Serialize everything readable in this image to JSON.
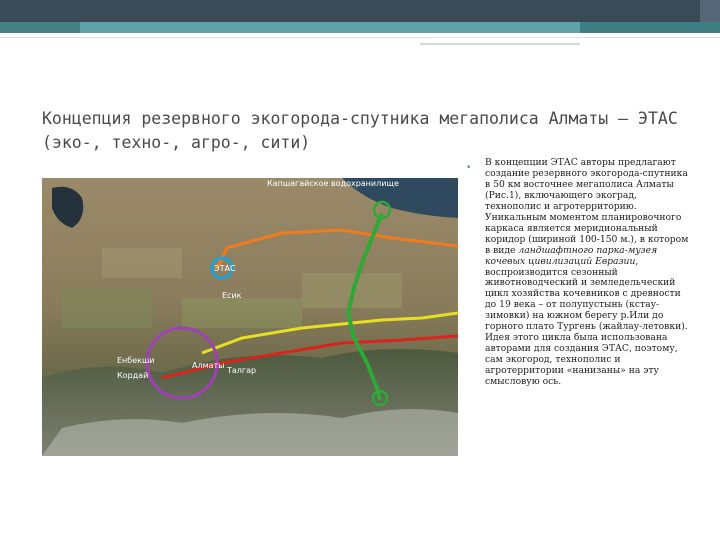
{
  "slide": {
    "title": "Концепция резервного экогорода-спутника мегаполиса Алматы – ЭТАС (эко-, техно-, агро-, сити)"
  },
  "map": {
    "labels": {
      "lake": "Капшагайское водохранилище",
      "city_left": "Енбекши",
      "city_mid": "Алматы",
      "city_mid_left": "Кордай",
      "region": "Талгар",
      "village": "Есик",
      "site": "ЭТАС"
    },
    "route_colors": {
      "orange": "#f07a1c",
      "yellow": "#e6e020",
      "red": "#d8241c",
      "green": "#2fa836",
      "blue_circle": "#1aa3d8",
      "purple_circle": "#a040b8"
    }
  },
  "content": {
    "p1": "В концепции ЭТАС авторы предлагают создание резервного экогорода-спутника в 50 км восточнее мегаполиса Алматы (Рис.1), включающего экоград, технополис и агротерриторию. Уникальным моментом планировочного каркаса является меридиональный коридор (шириной 100-150 м.), в котором в виде ",
    "p1_italic": "ландшафтного парка-музея кочевых цивилизаций Евразии",
    "p2": ", воспроизводится сезонный животноводческий и земледельческий цикл хозяйства кочевников с древности до 19 века – от полупустынь (кстау-зимовки) на южном берегу р.Или до горного плато Тургень (жайлау-летовки). Идея этого цикла была использована авторами для создания ЭТАС, поэтому, сам экогород, технополис и агротерритории «нанизаны» на эту смысловую ось."
  }
}
